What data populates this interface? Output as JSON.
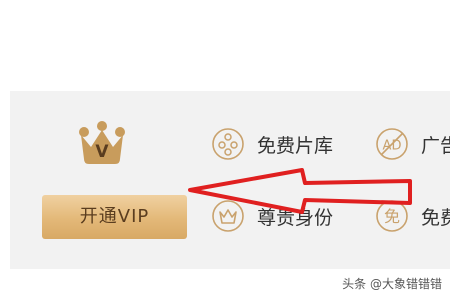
{
  "vip": {
    "crown_icon": "crown-v-icon",
    "crown_letter": "V",
    "button_label": "开通VIP",
    "accent_color": "#e3b878"
  },
  "features": [
    {
      "icon": "film-reel-icon",
      "label": "免费片库"
    },
    {
      "icon": "ad-circle-icon",
      "label": "广告"
    },
    {
      "icon": "crown-badge-icon",
      "label": "尊贵身份"
    },
    {
      "icon": "free-badge-icon",
      "label": "免费",
      "glyph": "免"
    }
  ],
  "annotation": {
    "arrow_color": "#e02020"
  },
  "watermark": {
    "text": "头条 @大象错错错"
  }
}
